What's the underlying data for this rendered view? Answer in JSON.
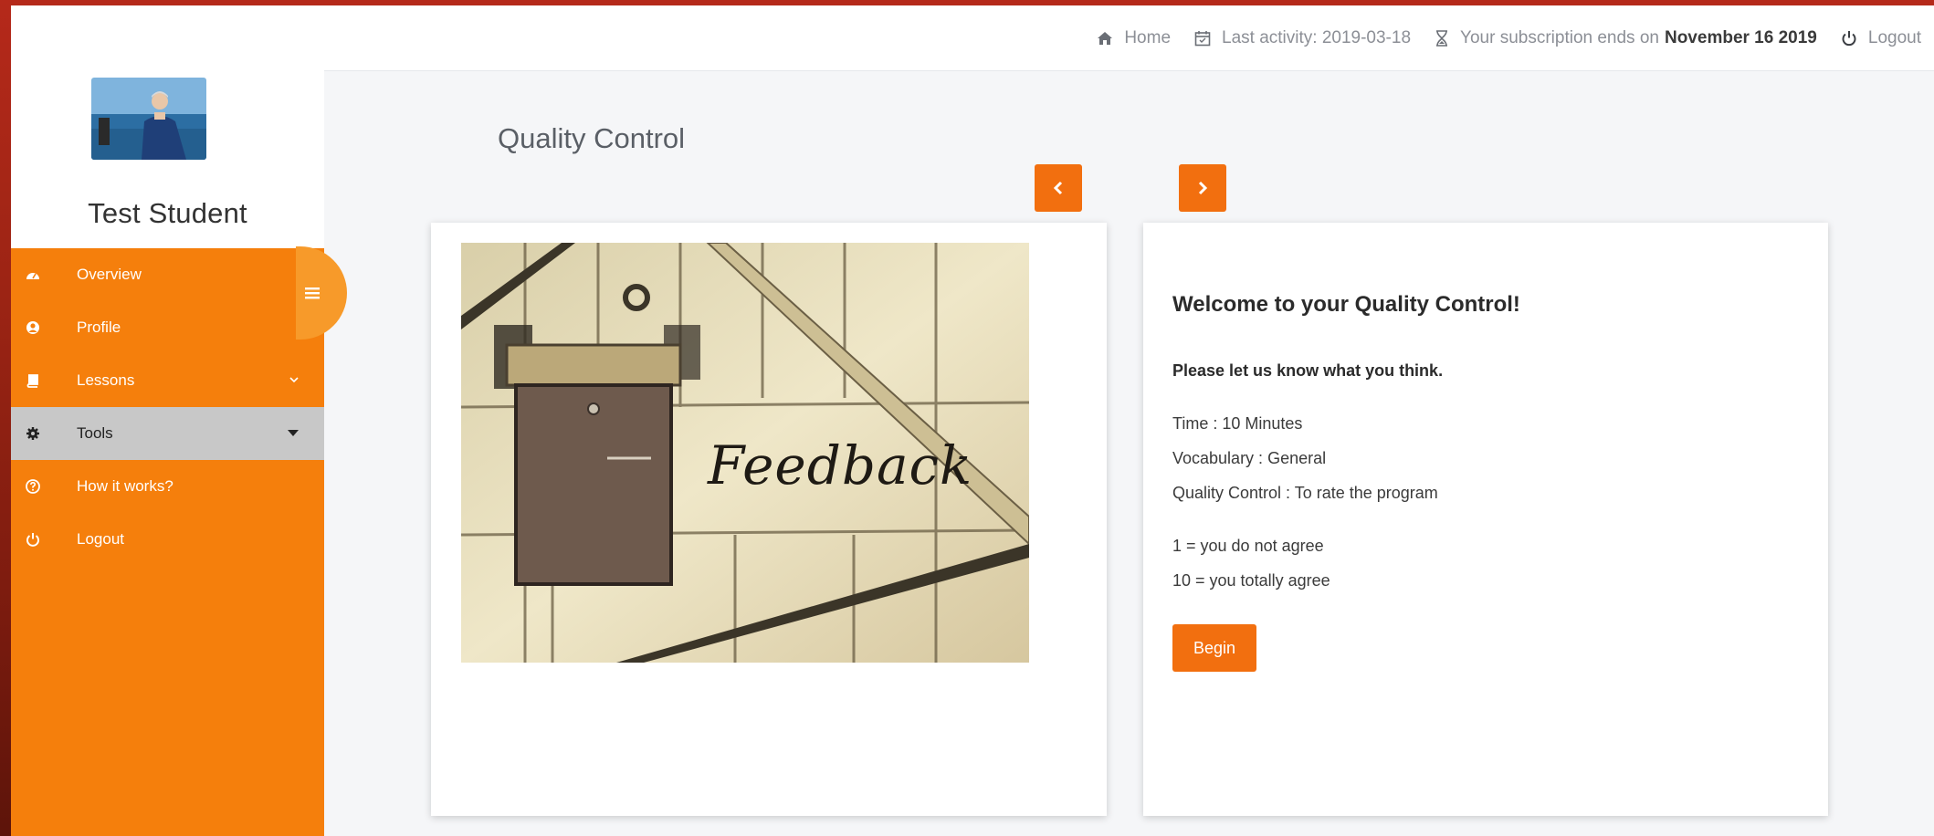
{
  "topbar": {
    "home": "Home",
    "last_activity": "Last activity: 2019-03-18",
    "subscription_prefix": "Your subscription ends on",
    "subscription_date": "November 16 2019",
    "logout": "Logout"
  },
  "sidebar": {
    "student_name": "Test Student",
    "items": [
      {
        "label": "Overview",
        "icon": "dashboard-icon"
      },
      {
        "label": "Profile",
        "icon": "user-circle-icon"
      },
      {
        "label": "Lessons",
        "icon": "book-icon",
        "has_caret": true
      },
      {
        "label": "Tools",
        "icon": "gear-icon",
        "has_caret": true,
        "active": true
      },
      {
        "label": "How it works?",
        "icon": "question-icon"
      },
      {
        "label": "Logout",
        "icon": "power-icon"
      }
    ]
  },
  "main": {
    "heading": "Quality Control",
    "image_text": "Feedback",
    "welcome": "Welcome to your Quality Control!",
    "intro": "Please let us know what you think.",
    "info_lines": [
      "Time : 10 Minutes",
      "Vocabulary : General",
      "Quality Control : To rate the program"
    ],
    "scale_lines": [
      "1 = you do not agree",
      "10 = you totally agree"
    ],
    "begin_label": "Begin"
  },
  "colors": {
    "accent": "#f26f0f",
    "sidebar_bg": "#f57f0c",
    "toggle_bg": "#f79a2a",
    "active_item_bg": "#c8c8c8",
    "background_frame": "#b5291a"
  }
}
